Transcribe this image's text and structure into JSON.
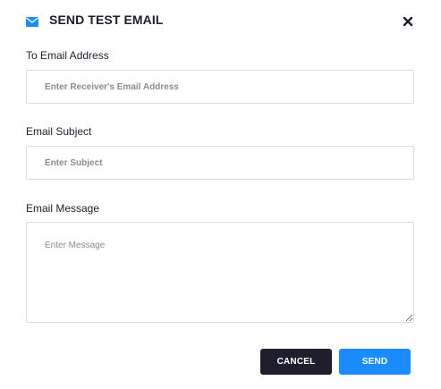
{
  "dialog": {
    "title": "SEND TEST EMAIL",
    "title_icon": "mail-icon",
    "close_icon": "close-icon"
  },
  "fields": {
    "to": {
      "label": "To Email Address",
      "placeholder": "Enter Receiver's Email Address",
      "value": ""
    },
    "subject": {
      "label": "Email Subject",
      "placeholder": "Enter Subject",
      "value": ""
    },
    "message": {
      "label": "Email Message",
      "placeholder": "Enter Message",
      "value": ""
    }
  },
  "actions": {
    "cancel_label": "CANCEL",
    "send_label": "SEND"
  },
  "colors": {
    "accent": "#1a8cff",
    "dark": "#1e1e2d",
    "border": "#dcdcdc"
  }
}
